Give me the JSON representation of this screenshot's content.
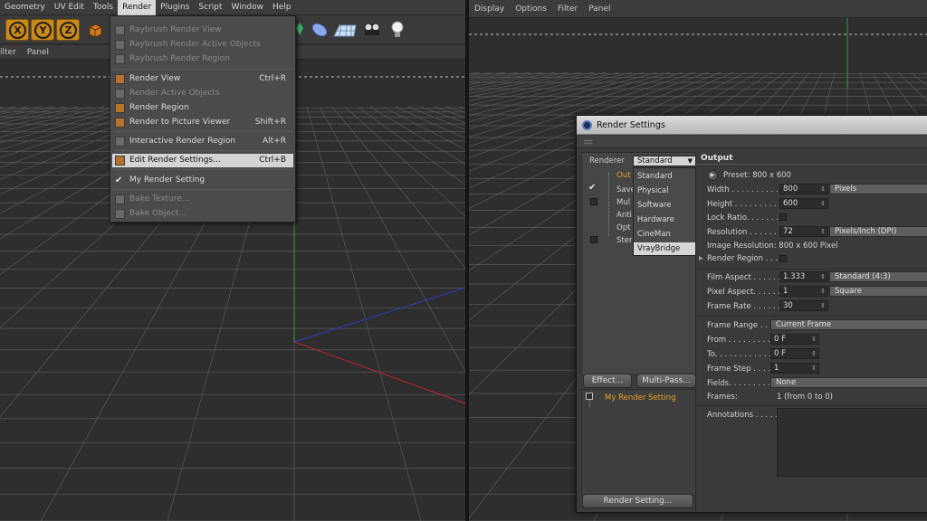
{
  "menubar": {
    "items": [
      "Geometry",
      "UV Edit",
      "Tools",
      "Render",
      "Plugins",
      "Script",
      "Window",
      "Help"
    ]
  },
  "toolbar": {
    "axis_x": "X",
    "axis_y": "Y",
    "axis_z": "Z"
  },
  "left_subbar": {
    "items": [
      "ilter",
      "Panel"
    ]
  },
  "render_menu": {
    "items": [
      {
        "label": "Raybrush Render View",
        "shortcut": "",
        "disabled": true
      },
      {
        "label": "Raybrush Render Active Objects",
        "shortcut": "",
        "disabled": true
      },
      {
        "label": "Raybrush Render Region",
        "shortcut": "",
        "disabled": true
      },
      {
        "label": "Render View",
        "shortcut": "Ctrl+R",
        "disabled": false
      },
      {
        "label": "Render Active Objects",
        "shortcut": "",
        "disabled": true
      },
      {
        "label": "Render Region",
        "shortcut": "",
        "disabled": false
      },
      {
        "label": "Render to Picture Viewer",
        "shortcut": "Shift+R",
        "disabled": false
      },
      {
        "label": "Interactive Render Region",
        "shortcut": "Alt+R",
        "disabled": false
      },
      {
        "label": "Edit Render Settings...",
        "shortcut": "Ctrl+B",
        "disabled": false
      },
      {
        "label": "My Render Setting",
        "shortcut": "",
        "disabled": false
      },
      {
        "label": "Bake Texture...",
        "shortcut": "",
        "disabled": true
      },
      {
        "label": "Bake Object...",
        "shortcut": "",
        "disabled": true
      }
    ]
  },
  "right_menubar": {
    "items": [
      "Display",
      "Options",
      "Filter",
      "Panel"
    ]
  },
  "render_settings": {
    "title": "Render Settings",
    "renderer_label": "Renderer",
    "renderer_value": "Standard",
    "renderer_options": [
      "Standard",
      "Physical",
      "Software",
      "Hardware",
      "CineMan",
      "VrayBridge"
    ],
    "tree": [
      "Out",
      "Save",
      "Mul",
      "Anti",
      "Opt",
      "Ster"
    ],
    "effect_button": "Effect...",
    "multipass_button": "Multi-Pass...",
    "setting_name": "My Render Setting",
    "render_setting_button": "Render Setting...",
    "section": "Output",
    "preset": "Preset: 800 x 600",
    "fields": {
      "width_label": "Width . . . . . . . . . .",
      "width": "800",
      "width_unit": "Pixels",
      "height_label": "Height . . . . . . . . .",
      "height": "600",
      "lock_ratio_label": "Lock Ratio. . . . . . .",
      "resolution_label": "Resolution . . . . . .",
      "resolution": "72",
      "resolution_unit": "Pixels/Inch (DPI)",
      "image_resolution": "Image Resolution: 800 x 600 Pixel",
      "render_region_label": "Render Region . . .",
      "film_aspect_label": "Film Aspect . . . . . .",
      "film_aspect": "1.333",
      "film_aspect_preset": "Standard (4:3)",
      "pixel_aspect_label": "Pixel Aspect. . . . . .",
      "pixel_aspect": "1",
      "pixel_aspect_preset": "Square",
      "frame_rate_label": "Frame Rate . . . . . .",
      "frame_rate": "30",
      "frame_range_label": "Frame Range . . . .",
      "frame_range": "Current Frame",
      "from_label": "From . . . . . . . . . . .",
      "from": "0 F",
      "to_label": "To. . . . . . . . . . . . .",
      "to": "0 F",
      "frame_step_label": "Frame Step . . . . . .",
      "frame_step": "1",
      "fields_label": "Fields. . . . . . . . . . .",
      "fields_value": "None",
      "frames_label": "Frames:",
      "frames_value": "1 (from 0 to 0)",
      "annotations_label": "Annotations . . . . ."
    }
  },
  "colors": {
    "accent": "#e5a220",
    "x_axis": "#c0262c",
    "y_axis": "#22a832",
    "z_axis": "#2a3fc8"
  }
}
